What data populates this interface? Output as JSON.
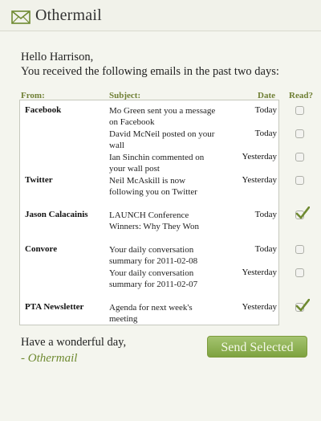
{
  "app": {
    "title": "Othermail"
  },
  "greeting": {
    "line1": "Hello Harrison,",
    "line2": "You received the following emails in the past two days:"
  },
  "columns": {
    "from": "From:",
    "subject": "Subject:",
    "date": "Date",
    "read": "Read?"
  },
  "emails": [
    {
      "from": "Facebook",
      "subject": "Mo Green sent you a message on Facebook",
      "date": "Today",
      "read": false
    },
    {
      "from": "",
      "subject": "David McNeil posted on your wall",
      "date": "Today",
      "read": false
    },
    {
      "from": "",
      "subject": "Ian Sinchin commented on your wall post",
      "date": "Yesterday",
      "read": false
    },
    {
      "from": "Twitter",
      "subject": "Neil McAskill is now following you on Twitter",
      "date": "Yesterday",
      "read": false
    },
    {
      "from": "Jason Calacainis",
      "subject": "LAUNCH Conference Winners: Why They Won",
      "date": "Today",
      "read": true
    },
    {
      "from": "Convore",
      "subject": "Your daily conversation summary for 2011-02-08",
      "date": "Today",
      "read": false
    },
    {
      "from": "",
      "subject": "Your daily conversation summary for 2011-02-07",
      "date": "Yesterday",
      "read": false
    },
    {
      "from": "PTA Newsletter",
      "subject": "Agenda for next week's meeting",
      "date": "Yesterday",
      "read": true
    }
  ],
  "footer": {
    "signoff": "Have a wonderful day,",
    "signature": "- Othermail",
    "send_button": "Send Selected"
  },
  "colors": {
    "accent": "#6f8a31",
    "button": "#8eae52"
  }
}
